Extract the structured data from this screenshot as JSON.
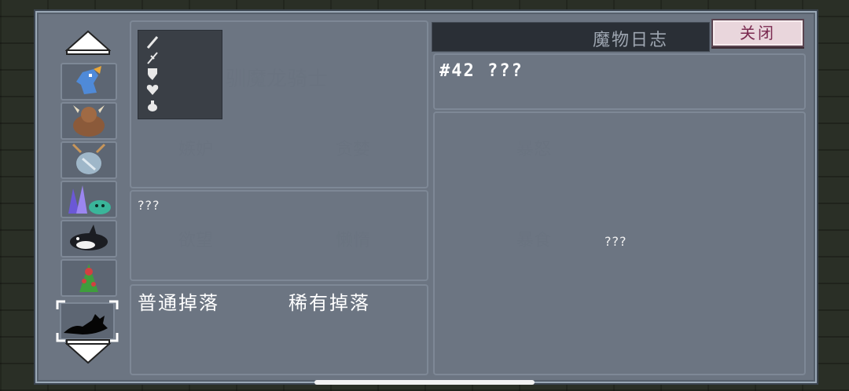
{
  "header": {
    "title": "魔物日志",
    "close_label": "关闭"
  },
  "monster": {
    "title": "#42 ???",
    "description": "???",
    "main_info": "???",
    "stat_icons": [
      "sword-icon",
      "sword-icon",
      "shield-icon",
      "heart-icon",
      "drop-icon"
    ]
  },
  "drops": {
    "common_label": "普通掉落",
    "rare_label": "稀有掉落"
  },
  "sidebar": {
    "items": [
      {
        "icon": "blue-bird-monster-icon"
      },
      {
        "icon": "minotaur-monster-icon"
      },
      {
        "icon": "ghost-deer-monster-icon"
      },
      {
        "icon": "crystal-slime-monster-icon"
      },
      {
        "icon": "orca-monster-icon"
      },
      {
        "icon": "plant-monster-icon"
      },
      {
        "icon": "unknown-silhouette-monster-icon"
      }
    ]
  },
  "colors": {
    "panel": "#6c7582",
    "close_bg": "#e9d6dc",
    "close_text": "#7a2a50",
    "header_bg": "#2a2f36"
  }
}
